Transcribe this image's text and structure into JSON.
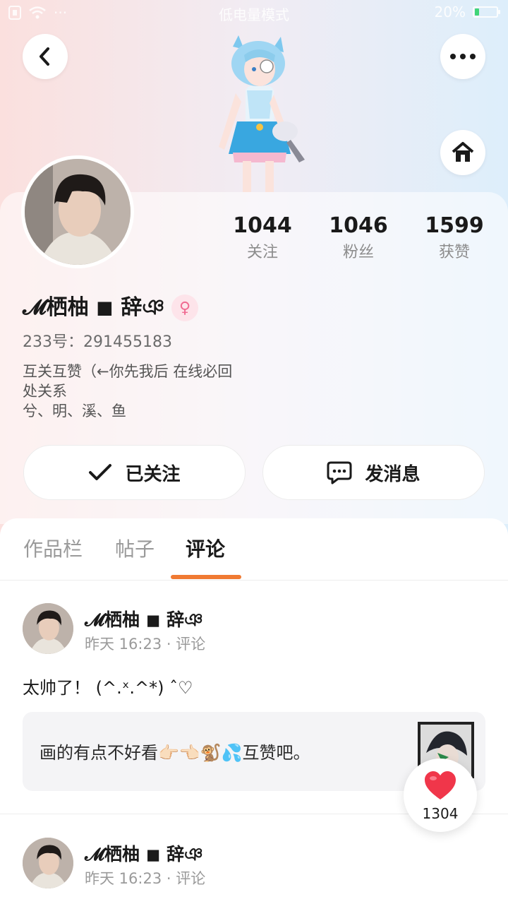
{
  "status_bar": {
    "mode": "低电量模式",
    "battery": "20%",
    "battery_level": 0.2
  },
  "header": {
    "back_icon": "chevron-left-icon",
    "more_icon": "more-dots-icon",
    "home_icon": "home-icon"
  },
  "profile": {
    "name": "𝓜栖柚 ◼ 辞ঞ",
    "gender_symbol": "♀",
    "id_line": "233号：291455183",
    "bio_lines": [
      "互关互赞（←你先我后 在线必回",
      "处关系",
      "兮、明、溪、鱼"
    ],
    "stats": [
      {
        "value": "1044",
        "label": "关注"
      },
      {
        "value": "1046",
        "label": "粉丝"
      },
      {
        "value": "1599",
        "label": "获赞"
      }
    ]
  },
  "actions": {
    "follow_label": "已关注",
    "message_label": "发消息"
  },
  "tabs": [
    "作品栏",
    "帖子",
    "评论"
  ],
  "active_tab": "评论",
  "comments": [
    {
      "author": "𝓜栖柚 ◼ 辞ঞ",
      "meta": "昨天 16:23 · 评论",
      "text": "太帅了！ (^.ˣ.^*) ˆ♡",
      "quote": "画的有点不好看👉🏻👈🏻🐒💦互赞吧。"
    },
    {
      "author": "𝓜栖柚 ◼ 辞ঞ",
      "meta": "昨天 16:23 · 评论"
    }
  ],
  "like_fab": {
    "count": "1304"
  },
  "colors": {
    "accent": "#f07a32",
    "heart": "#f0364a",
    "gender_bg": "#fde4ea",
    "gender_fg": "#f06a91"
  }
}
